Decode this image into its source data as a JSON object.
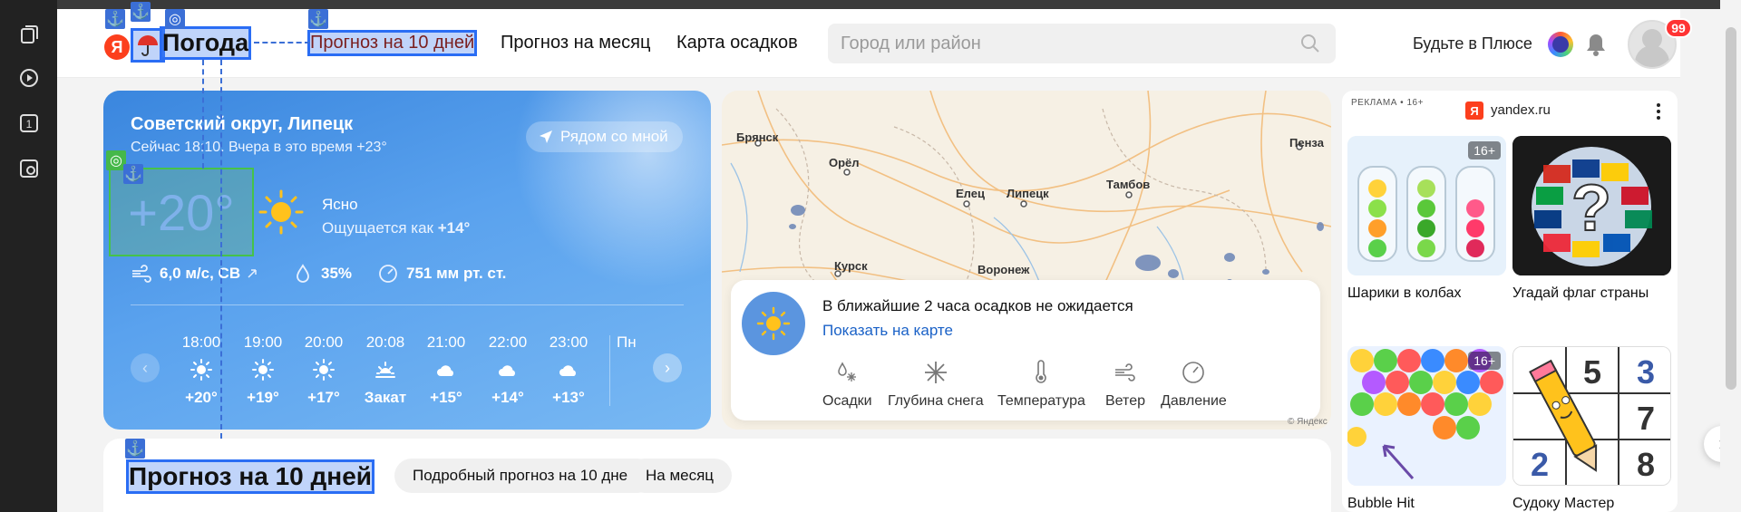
{
  "header": {
    "logo_letter": "Я",
    "logo_text": "Погода",
    "nav": [
      "Прогноз на 10 дней",
      "Прогноз на месяц",
      "Карта осадков"
    ],
    "search_placeholder": "Город или район",
    "plus_text": "Будьте в Плюсе",
    "notification_badge": "99"
  },
  "weather": {
    "location": "Советский округ, Липецк",
    "now_text": "Сейчас 18:10. Вчера в это время +23°",
    "near_button": "Рядом со мной",
    "temperature": "+20°",
    "condition": "Ясно",
    "feels_like_label": "Ощущается как",
    "feels_like_value": "+14°",
    "wind": "6,0 м/с, СВ",
    "humidity": "35%",
    "pressure": "751 мм рт. ст.",
    "hourly": [
      {
        "time": "18:00",
        "icon": "sun",
        "temp": "+20°"
      },
      {
        "time": "19:00",
        "icon": "sun",
        "temp": "+19°"
      },
      {
        "time": "20:00",
        "icon": "sun",
        "temp": "+17°"
      },
      {
        "time": "20:08",
        "icon": "sunset",
        "temp": "Закат"
      },
      {
        "time": "21:00",
        "icon": "cloud-night",
        "temp": "+15°"
      },
      {
        "time": "22:00",
        "icon": "cloud-night",
        "temp": "+14°"
      },
      {
        "time": "23:00",
        "icon": "cloud-night",
        "temp": "+13°"
      }
    ],
    "hourly_cut_label": "Пн"
  },
  "map": {
    "cities": [
      "Брянск",
      "Орёл",
      "Елец",
      "Липецк",
      "Тамбов",
      "Пенза",
      "Курск",
      "Воронеж"
    ],
    "precip_message": "В ближайшие 2 часа осадков не ожидается",
    "show_on_map": "Показать на карте",
    "layers": [
      "Осадки",
      "Глубина снега",
      "Температура",
      "Ветер",
      "Давление"
    ],
    "copyright": "© Яндекс"
  },
  "ads": {
    "label": "РЕКЛАМА • 16+",
    "domain": "yandex.ru",
    "age_badge": "16+",
    "items": [
      {
        "title": "Шарики в колбах"
      },
      {
        "title": "Угадай флаг страны"
      },
      {
        "title": "Bubble Hit"
      },
      {
        "title": "Судоку Мастер"
      }
    ]
  },
  "forecast": {
    "title": "Прогноз на 10 дней",
    "chips": [
      "Подробный прогноз на 10 дней",
      "На месяц"
    ]
  },
  "colors": {
    "accent": "#2a6df4",
    "weather_card": "#4a92e6",
    "link": "#1b62c7",
    "ya_red": "#fc3f1d"
  }
}
